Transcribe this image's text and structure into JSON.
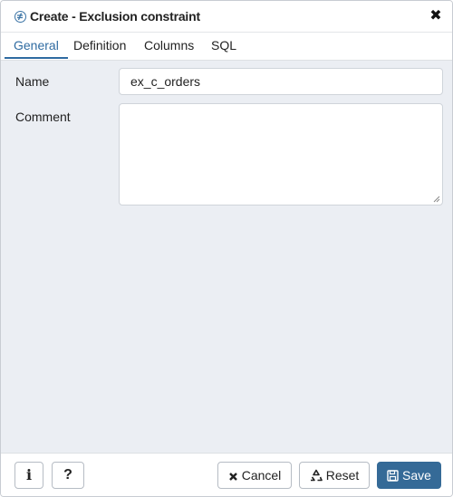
{
  "dialog": {
    "title": "Create - Exclusion constraint",
    "title_icon": "exclusion-constraint-icon",
    "close_glyph": "✖"
  },
  "tabs": [
    {
      "label": "General",
      "active": true
    },
    {
      "label": "Definition",
      "active": false
    },
    {
      "label": "Columns",
      "active": false
    },
    {
      "label": "SQL",
      "active": false
    }
  ],
  "form": {
    "name_label": "Name",
    "name_value": "ex_c_orders",
    "comment_label": "Comment",
    "comment_value": ""
  },
  "footer": {
    "info_label": "i",
    "help_label": "?",
    "cancel_label": "Cancel",
    "cancel_icon": "close-icon",
    "reset_label": "Reset",
    "reset_icon": "recycle-icon",
    "save_label": "Save",
    "save_icon": "floppy-disk-icon"
  },
  "colors": {
    "accent": "#2f6ba1",
    "save_button": "#356a97",
    "body_background": "#ebeef3"
  }
}
